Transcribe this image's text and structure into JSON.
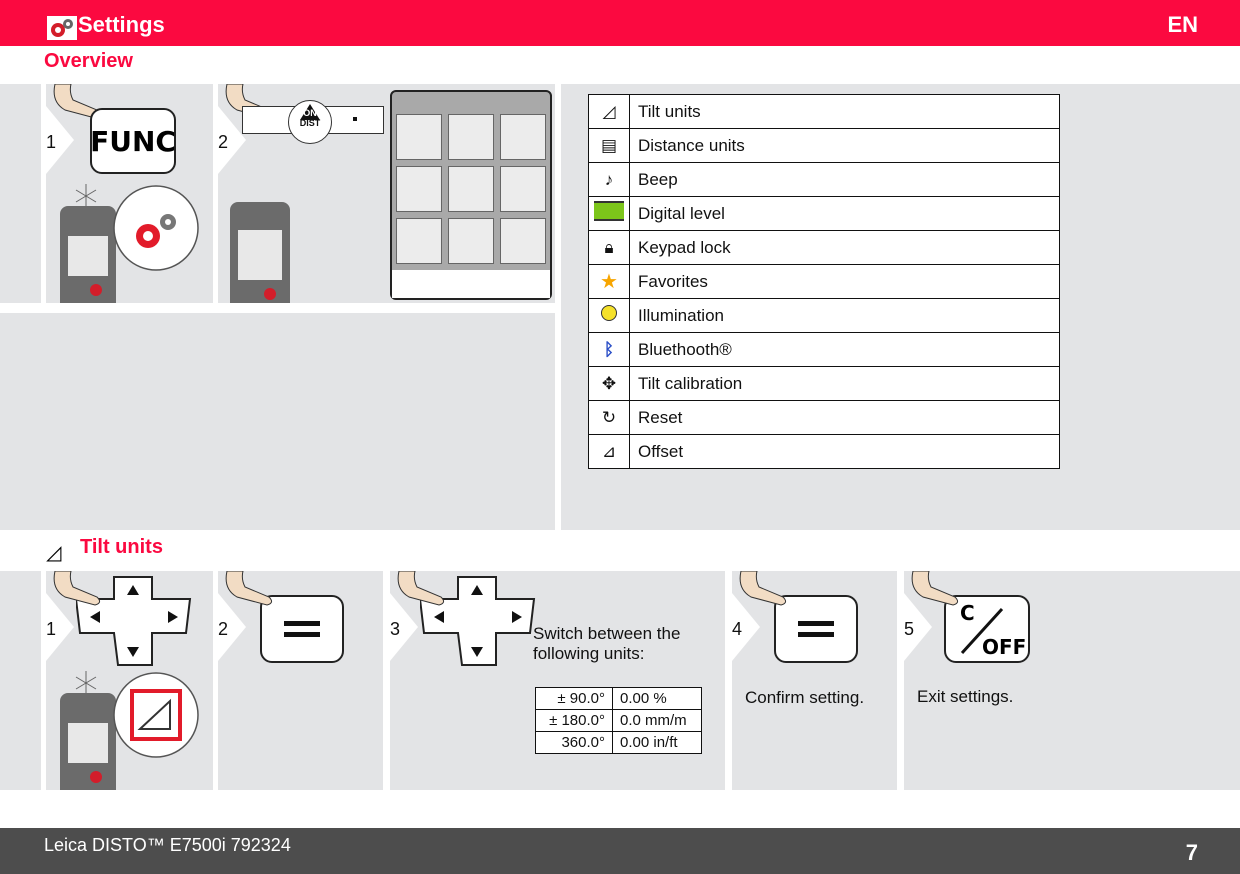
{
  "header": {
    "title": "Settings",
    "language": "EN",
    "icon": "settings-gear-icon",
    "accent_color": "#fb0940"
  },
  "overview": {
    "heading": "Overview",
    "steps": [
      {
        "number": "1",
        "key_label": "FUNC",
        "display_icon": "settings-gear-icon"
      },
      {
        "number": "2",
        "key_label_top": "ON",
        "key_label_bottom": "DIST",
        "display": "3x3 menu grid"
      }
    ],
    "menu_items": [
      {
        "icon": "tilt-units-icon",
        "label": "Tilt units"
      },
      {
        "icon": "distance-units-icon",
        "label": "Distance units"
      },
      {
        "icon": "beep-icon",
        "label": "Beep"
      },
      {
        "icon": "digital-level-icon",
        "label": "Digital level"
      },
      {
        "icon": "keypad-lock-icon",
        "label": "Keypad lock"
      },
      {
        "icon": "favorites-star-icon",
        "label": "Favorites"
      },
      {
        "icon": "illumination-bulb-icon",
        "label": "Illumination"
      },
      {
        "icon": "bluetooth-icon",
        "label": "Bluethooth®"
      },
      {
        "icon": "tilt-calibration-icon",
        "label": "Tilt calibration"
      },
      {
        "icon": "reset-icon",
        "label": "Reset"
      },
      {
        "icon": "offset-icon",
        "label": "Offset"
      }
    ]
  },
  "tilt_units": {
    "heading": "Tilt units",
    "steps": [
      {
        "number": "1",
        "key": "navigation-cross"
      },
      {
        "number": "2",
        "key": "equals"
      },
      {
        "number": "3",
        "key": "navigation-cross",
        "text": "Switch between the following units:"
      },
      {
        "number": "4",
        "key": "equals",
        "text": "Confirm setting."
      },
      {
        "number": "5",
        "key_label_top": "C",
        "key_label_bottom": "OFF",
        "text": "Exit settings."
      }
    ],
    "units": [
      {
        "angle": "± 90.0°",
        "slope": "0.00 %"
      },
      {
        "angle": "± 180.0°",
        "slope": "0.0 mm/m"
      },
      {
        "angle": "360.0°",
        "slope": "0.00 in/ft"
      }
    ]
  },
  "footer": {
    "product": "Leica DISTO™ E7500i 792324",
    "page": "7"
  }
}
